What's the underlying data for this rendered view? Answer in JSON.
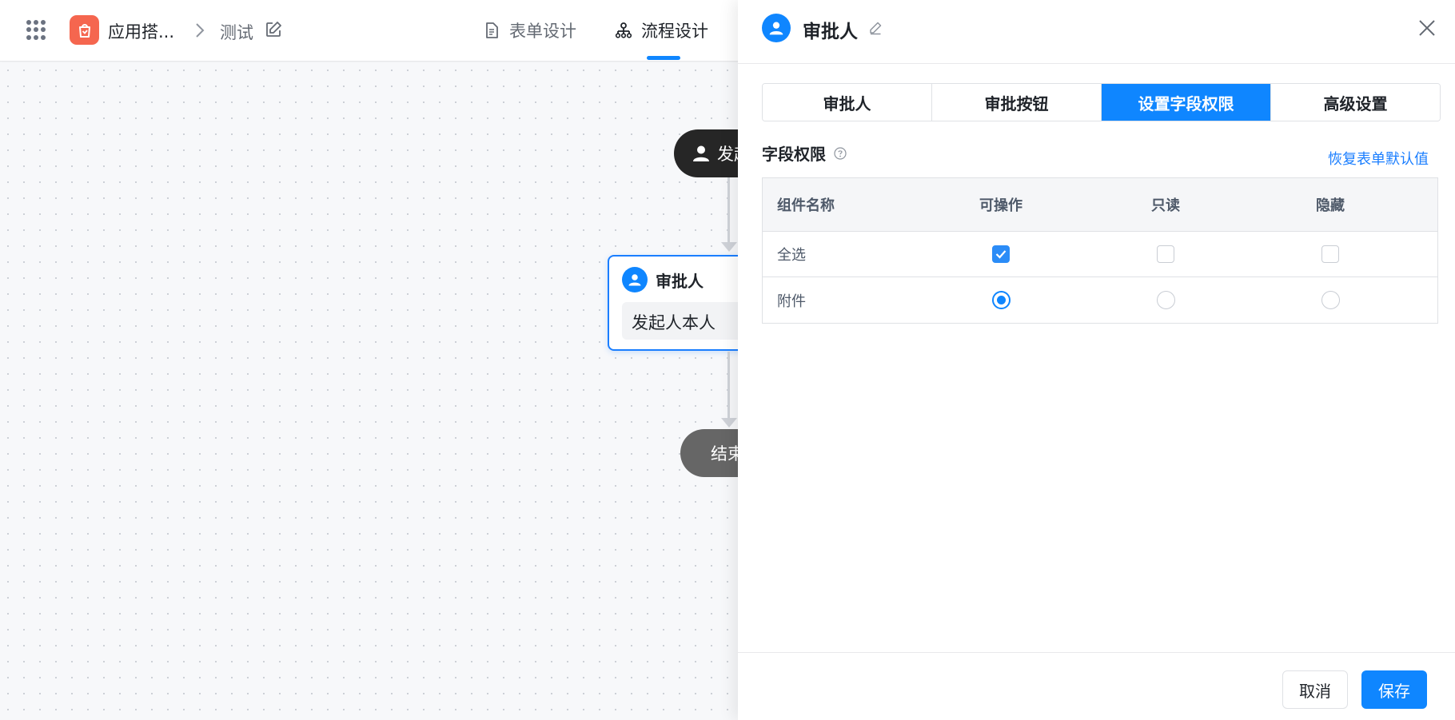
{
  "header": {
    "app_name": "应用搭...",
    "breadcrumb_current": "测试",
    "tabs": [
      {
        "label": "表单设计",
        "active": false
      },
      {
        "label": "流程设计",
        "active": true
      }
    ],
    "logo_color": "#f5664f"
  },
  "canvas": {
    "start_node_label": "发起人",
    "approver_node": {
      "title": "审批人",
      "content": "发起人本人"
    },
    "end_node_label": "结束"
  },
  "drawer": {
    "title": "审批人",
    "tabs": [
      {
        "label": "审批人",
        "active": false
      },
      {
        "label": "审批按钮",
        "active": false
      },
      {
        "label": "设置字段权限",
        "active": true
      },
      {
        "label": "高级设置",
        "active": false
      }
    ],
    "section_title": "字段权限",
    "reset_link": "恢复表单默认值",
    "table": {
      "columns": [
        "组件名称",
        "可操作",
        "只读",
        "隐藏"
      ],
      "rows": [
        {
          "name": "全选",
          "type": "checkbox",
          "editable": true,
          "readonly": false,
          "hidden": false
        },
        {
          "name": "附件",
          "type": "radio",
          "editable": true,
          "readonly": false,
          "hidden": false
        }
      ]
    },
    "cancel_label": "取消",
    "save_label": "保存"
  },
  "colors": {
    "accent": "#0f86ff",
    "start_node": "#262626",
    "end_node": "#666666"
  }
}
